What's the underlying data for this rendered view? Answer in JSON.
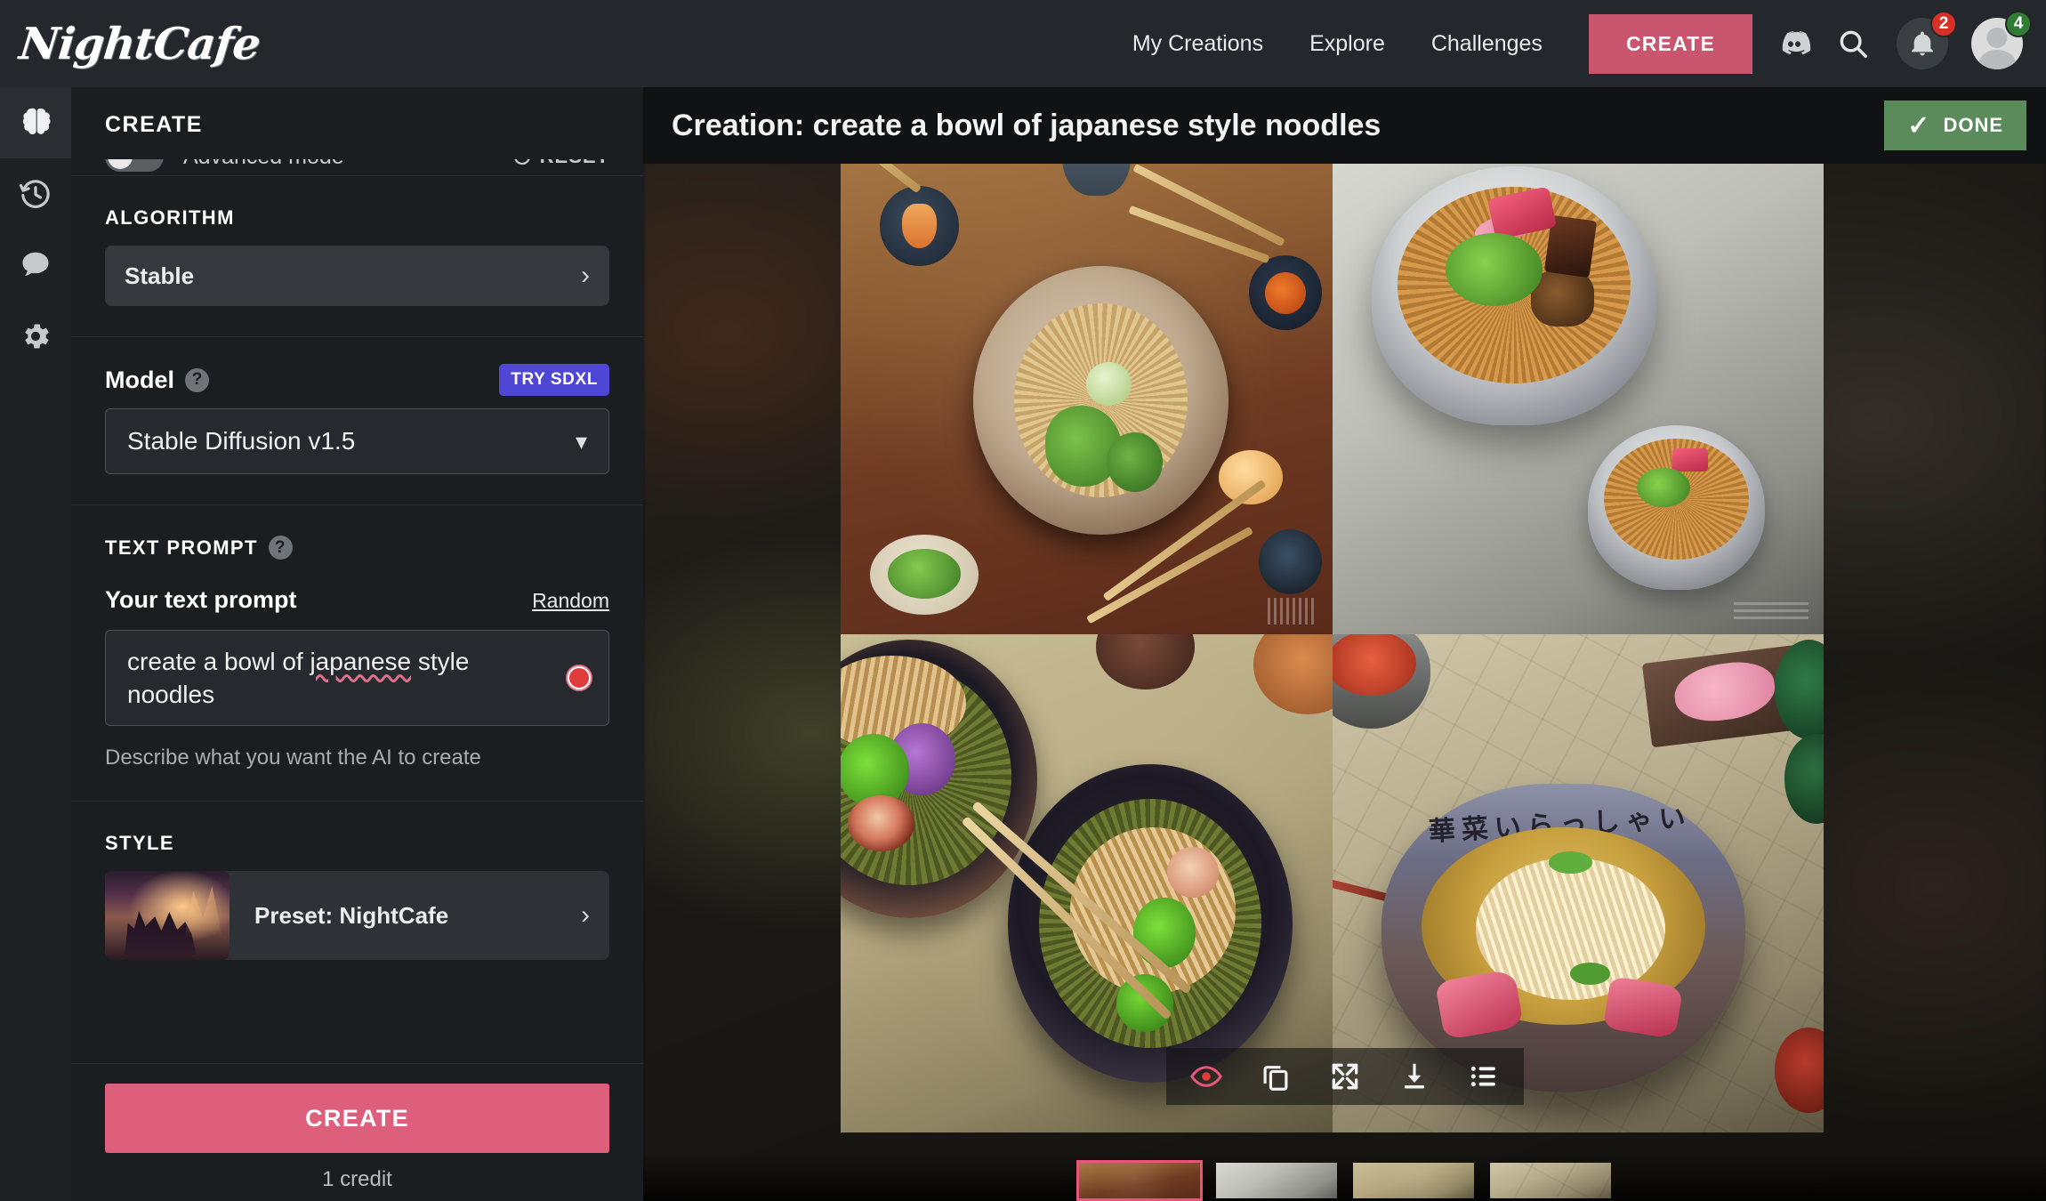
{
  "brand": {
    "name": "NightCafe"
  },
  "header": {
    "nav": [
      {
        "label": "My Creations"
      },
      {
        "label": "Explore"
      },
      {
        "label": "Challenges"
      }
    ],
    "create_button": "CREATE",
    "icons": {
      "discord": "discord-icon",
      "search": "search-icon",
      "notifications": "bell-icon",
      "avatar": "avatar-icon"
    },
    "notification_count": "2",
    "avatar_count": "4",
    "accent_color": "#c9556e"
  },
  "rail": {
    "items": [
      {
        "name": "brain-icon",
        "label": "Create",
        "active": true
      },
      {
        "name": "history-icon",
        "label": "History",
        "active": false
      },
      {
        "name": "chat-icon",
        "label": "Chat",
        "active": false
      },
      {
        "name": "gear-icon",
        "label": "Settings",
        "active": false
      }
    ]
  },
  "panel": {
    "title": "CREATE",
    "advanced_mode": {
      "label": "Advanced mode",
      "enabled": false
    },
    "reset": {
      "label": "RESET",
      "icon": "refresh-icon"
    },
    "algorithm": {
      "section_label": "ALGORITHM",
      "value": "Stable"
    },
    "model": {
      "label": "Model",
      "help": "?",
      "badge": "TRY SDXL",
      "badge_color": "#4f46d6",
      "value": "Stable Diffusion v1.5"
    },
    "text_prompt": {
      "section_label": "TEXT PROMPT",
      "help": "?",
      "field_label": "Your text prompt",
      "random_label": "Random",
      "value_part1": "create a bowl of ",
      "value_misspelled": "japanese",
      "value_part2": " style noodles",
      "helper": "Describe what you want the AI to create"
    },
    "style": {
      "section_label": "STYLE",
      "value": "Preset: NightCafe"
    },
    "footer": {
      "create_label": "CREATE",
      "credit_label": "1 credit",
      "create_color": "#dd5f7c"
    }
  },
  "main": {
    "creation_title": "Creation: create a bowl of japanese style noodles",
    "done_button": {
      "label": "DONE",
      "icon": "check-icon",
      "color": "#5b8b5b"
    },
    "image_toolbar": [
      {
        "name": "eye-icon",
        "label": "Preview"
      },
      {
        "name": "copy-icon",
        "label": "Duplicate"
      },
      {
        "name": "expand-icon",
        "label": "Fullscreen"
      },
      {
        "name": "download-icon",
        "label": "Download"
      },
      {
        "name": "list-icon",
        "label": "Details"
      }
    ],
    "images": [
      {
        "alt": "Soba noodle bowl on warm wooden table with side dishes"
      },
      {
        "alt": "Ramen bowls with tuna and scallions on grey background"
      },
      {
        "alt": "Dark bowls of noodles with broccoli and purple cabbage"
      },
      {
        "alt": "Anime style ramen bowl with calligraphy and sashimi"
      }
    ],
    "thumbnails": [
      {
        "selected": true
      },
      {
        "selected": false
      },
      {
        "selected": false
      },
      {
        "selected": false
      }
    ],
    "selected_color": "#e7557a"
  }
}
